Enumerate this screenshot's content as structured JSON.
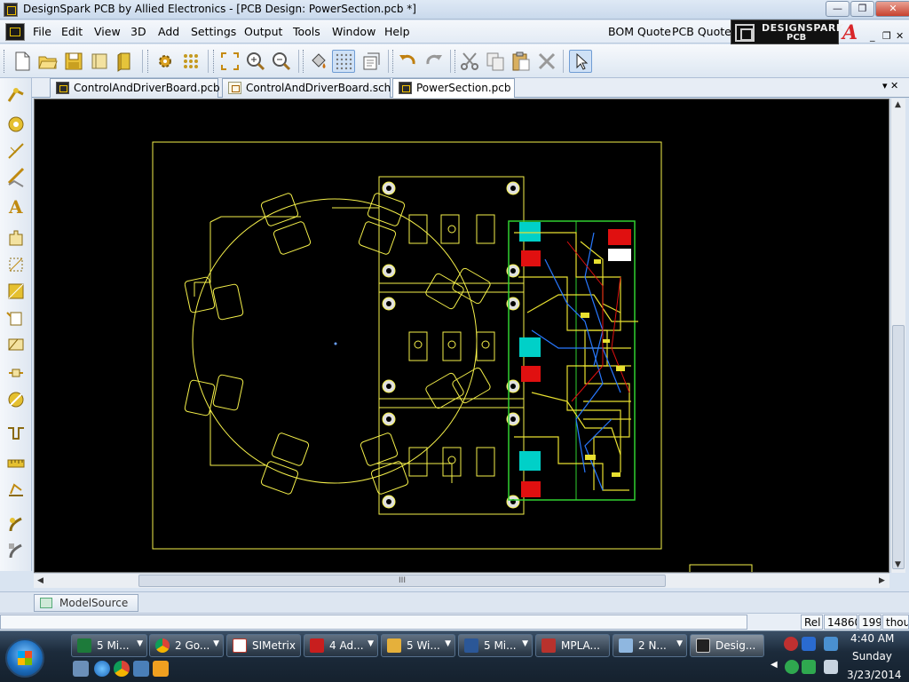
{
  "window": {
    "title": "DesignSpark PCB by Allied Electronics - [PCB Design: PowerSection.pcb *]",
    "minimize_icon": "minimize-icon",
    "maximize_icon": "restore-icon",
    "close_icon": "close-icon"
  },
  "menu": {
    "items": [
      "File",
      "Edit",
      "View",
      "3D",
      "Add",
      "Settings",
      "Output",
      "Tools",
      "Window",
      "Help"
    ],
    "extra": [
      "BOM Quote",
      "PCB Quote"
    ],
    "brand_line1": "DESIGNSPARK",
    "brand_line2": "PCB",
    "mdi_min": "_",
    "mdi_restore": "❐",
    "mdi_close": "✕"
  },
  "toolbar": {
    "icons": [
      "new-file-icon",
      "open-folder-icon",
      "save-icon",
      "open-library-icon",
      "library-book-icon",
      "component-gear-icon",
      "grid-dots-icon",
      "zoom-fit-icon",
      "zoom-in-icon",
      "zoom-out-icon",
      "paint-bucket-icon",
      "grid-toggle-icon",
      "properties-icon",
      "undo-icon",
      "redo-icon",
      "cut-icon",
      "copy-icon",
      "paste-icon",
      "delete-icon",
      "select-pointer-icon"
    ]
  },
  "tabs": [
    {
      "label": "ControlAndDriverBoard.pcb",
      "kind": "pcb"
    },
    {
      "label": "ControlAndDriverBoard.sch",
      "kind": "sch"
    },
    {
      "label": "PowerSection.pcb",
      "kind": "pcb",
      "active": true
    }
  ],
  "tab_strip_close": "▾ ✕",
  "side_tools": [
    "add-track-icon",
    "add-pad-icon",
    "add-shape-line-icon",
    "add-angled-line-icon",
    "add-copper-icon",
    "add-text-icon",
    "add-component-icon",
    "add-board-outline-icon",
    "add-area-icon",
    "add-doc-symbol-icon",
    "add-keepout-icon",
    "add-drill-icon",
    "add-via-icon",
    "measure-icon",
    "design-rule-icon",
    "edit-pad-icon",
    "edit-track-icon"
  ],
  "scrollbars": {
    "up": "▲",
    "down": "▼",
    "left": "◀",
    "right": "▶",
    "thumb_grip": "III"
  },
  "panels": {
    "model_source_tab": "ModelSource"
  },
  "status": {
    "mode": "Rel",
    "x": "14860",
    "y": "199",
    "units": "thou"
  },
  "taskbar": {
    "tasks": [
      {
        "label": "5 Mi...",
        "icon": "excel-icon",
        "color": "#1d7a3a"
      },
      {
        "label": "2 Go...",
        "icon": "chrome-icon",
        "color": "#db4437"
      },
      {
        "label": "SIMetrix",
        "icon": "simetrix-icon",
        "color": "#c0392b"
      },
      {
        "label": "4 Ad...",
        "icon": "adobe-pdf-icon",
        "color": "#c81e1e"
      },
      {
        "label": "5 Wi...",
        "icon": "explorer-folder-icon",
        "color": "#e5b03b"
      },
      {
        "label": "5 Mi...",
        "icon": "word-icon",
        "color": "#2b5797"
      },
      {
        "label": "MPLA...",
        "icon": "mplab-icon",
        "color": "#b8322d"
      },
      {
        "label": "2 N...",
        "icon": "notepad-icon",
        "color": "#8fb7e0"
      },
      {
        "label": "Desig...",
        "icon": "designspark-icon",
        "color": "#222222",
        "active": true
      }
    ],
    "quick_launch": [
      "show-desktop-icon",
      "ie-icon",
      "chrome-icon",
      "window-switch-icon",
      "media-player-icon"
    ],
    "tray_icons": [
      "antivirus-icon",
      "bluetooth-icon",
      "network-icon",
      "shield-icon",
      "action-center-icon",
      "volume-icon"
    ],
    "tray_arrow": "◀",
    "clock_time": "4:40 AM",
    "clock_day": "Sunday",
    "clock_date": "3/23/2014"
  },
  "colors": {
    "canvas": "#000000",
    "board_outline": "#f5f04a",
    "copper_top": "#e8e030",
    "copper_alt": "#2878ff",
    "pad_highlight": "#00d0c8",
    "pad_red": "#e01010",
    "silk_green": "#30d030"
  }
}
